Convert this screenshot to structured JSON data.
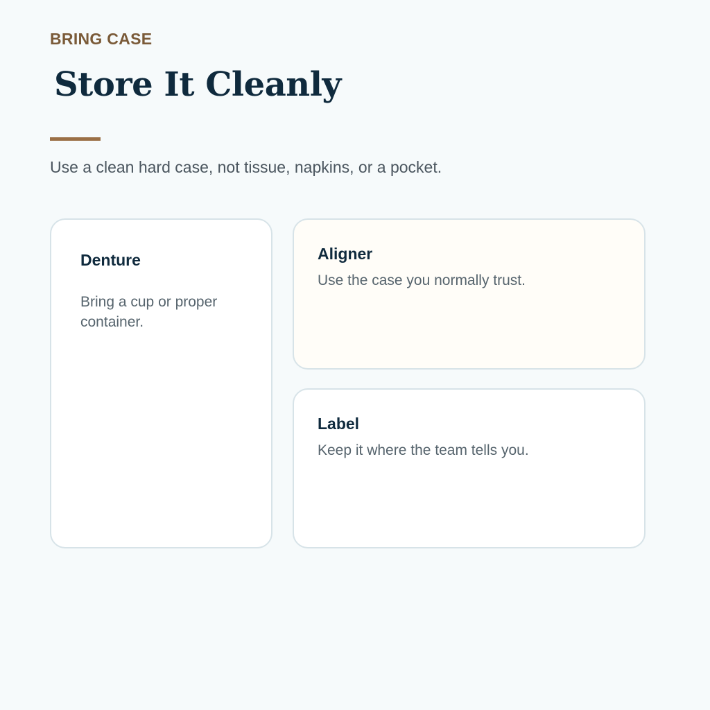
{
  "header": {
    "eyebrow": "BRING CASE",
    "title": "Store It Cleanly",
    "subtitle": "Use a clean hard case, not tissue, napkins, or a pocket."
  },
  "cards": [
    {
      "title": "Denture",
      "body": "Bring a cup or proper container."
    },
    {
      "title": "Aligner",
      "body": "Use the case you normally trust."
    },
    {
      "title": "Label",
      "body": "Keep it where the team tells you."
    }
  ],
  "colors": {
    "background": "#f6fafb",
    "accent": "#9a6f45",
    "eyebrow": "#7a5a38",
    "heading": "#0f2a3d",
    "highlight_card": "#fffdf8"
  }
}
